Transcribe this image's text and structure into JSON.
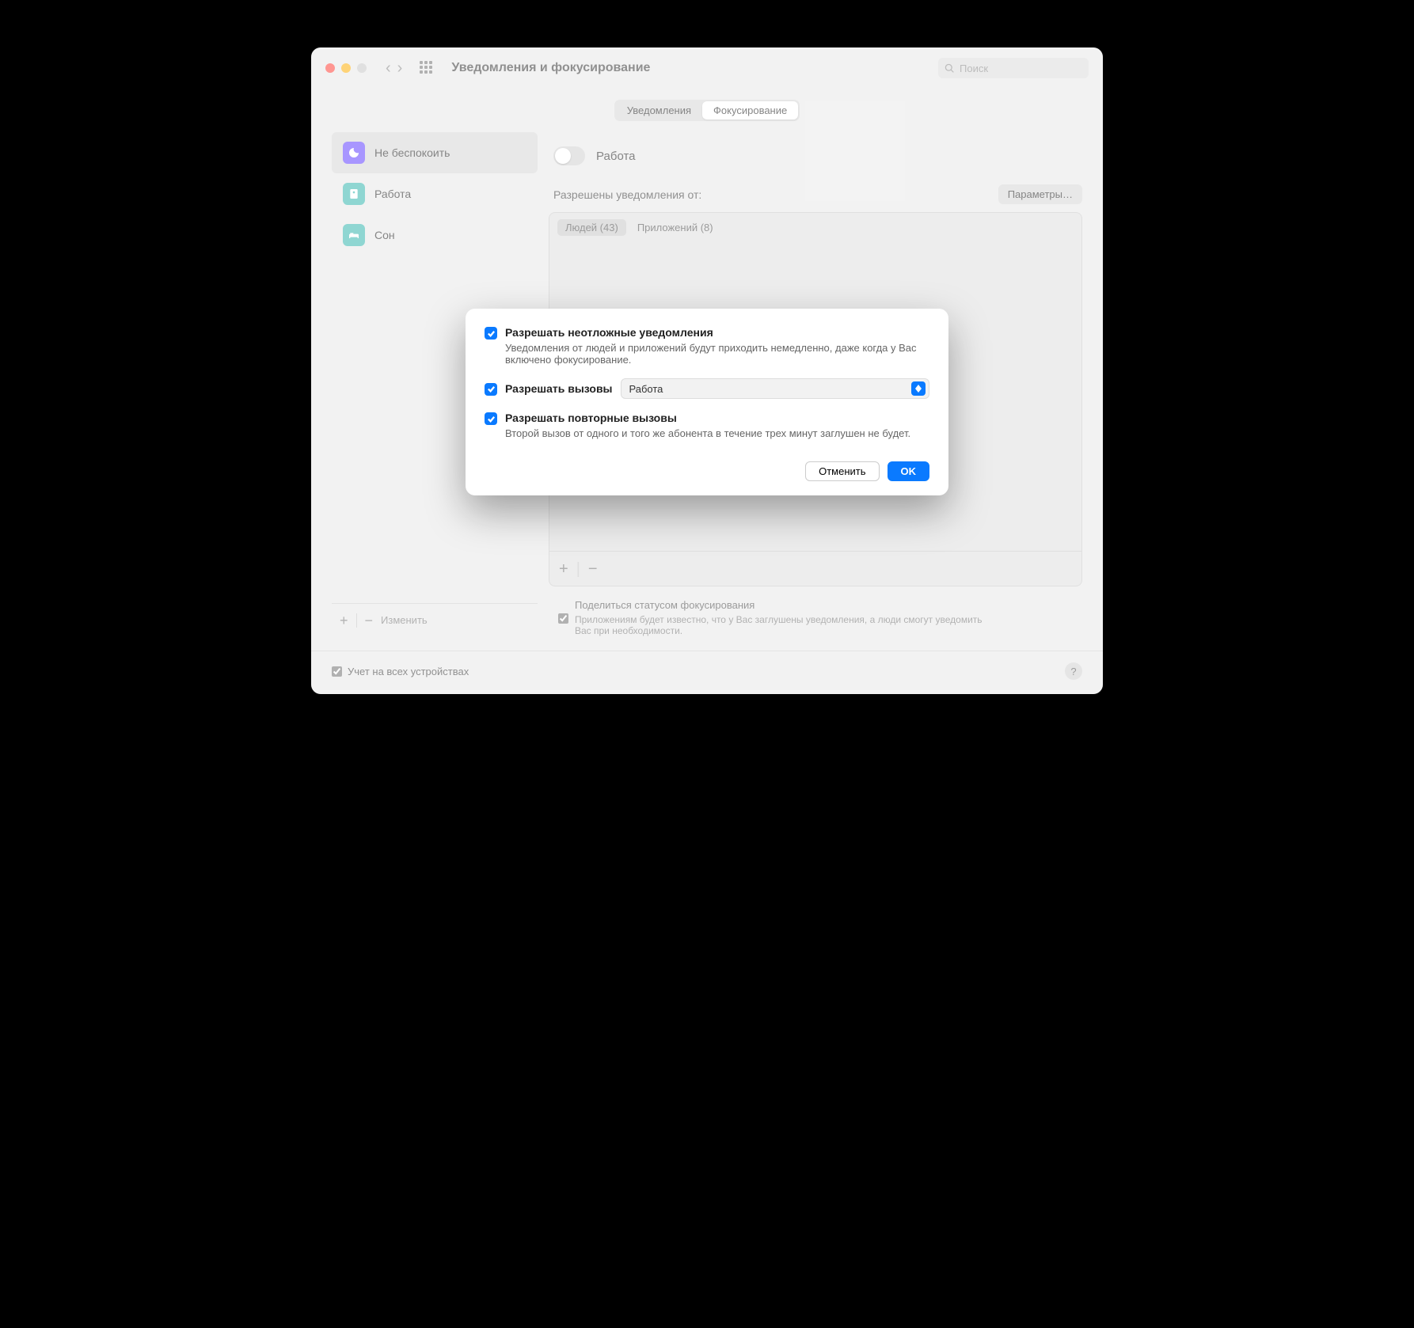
{
  "window_title": "Уведомления и фокусирование",
  "search_placeholder": "Поиск",
  "tabs": {
    "notifications": "Уведомления",
    "focus": "Фокусирование"
  },
  "sidebar": {
    "items": [
      {
        "label": "Не беспокоить",
        "color": "#7a5fff"
      },
      {
        "label": "Работа",
        "color": "#54c1bb"
      },
      {
        "label": "Сон",
        "color": "#54c1bb"
      }
    ],
    "edit": "Изменить"
  },
  "main": {
    "focus_name": "Работа",
    "allowed_label": "Разрешены уведомления от:",
    "params_btn": "Параметры…",
    "allowed_tabs": {
      "people": "Людей (43)",
      "apps": "Приложений (8)"
    },
    "share_label": "Поделиться статусом фокусирования",
    "share_sub": "Приложениям будет известно, что у Вас заглушены уведомления, а люди смогут уведомить Вас при необходимости."
  },
  "sync_label": "Учет на всех устройствах",
  "modal": {
    "urgent_label": "Разрешать неотложные уведомления",
    "urgent_sub": "Уведомления от людей и приложений будут приходить немедленно, даже когда у Вас включено фокусирование.",
    "calls_label": "Разрешать вызовы",
    "calls_select": "Работа",
    "repeat_label": "Разрешать повторные вызовы",
    "repeat_sub": "Второй вызов от одного и того же абонента в течение трех минут заглушен не будет.",
    "cancel": "Отменить",
    "ok": "OK"
  }
}
